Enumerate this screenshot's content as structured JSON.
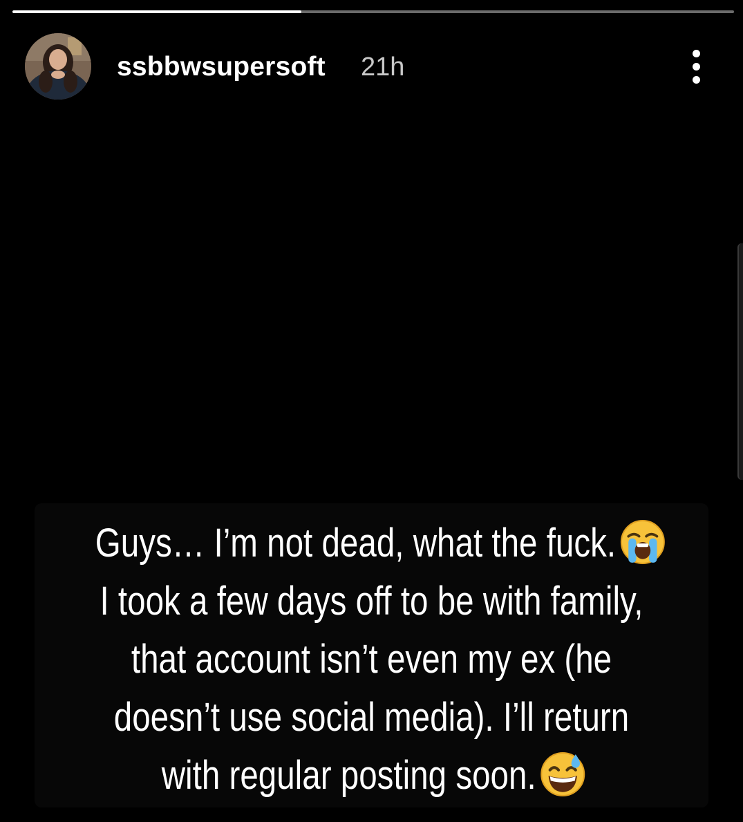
{
  "story": {
    "progress_fraction": 0.4,
    "colors": {
      "background": "#000000",
      "progress_track": "#6b6b6b",
      "progress_fill": "#ffffff",
      "text": "#ffffff",
      "timestamp": "#c8c8c8"
    }
  },
  "header": {
    "username": "ssbbwsupersoft",
    "timestamp": "21h",
    "avatar_icon": "profile-photo",
    "menu_icon": "more-vertical-icon"
  },
  "caption": {
    "lines": [
      "Guys… I’m not dead, what the fuck.",
      "I took a few days off to be with family,",
      "that account isn’t even my ex (he",
      "doesn’t use social media). I’ll return",
      "with regular posting soon."
    ],
    "emoji_1": "loudly-crying-face",
    "emoji_2": "grinning-face-with-sweat"
  }
}
